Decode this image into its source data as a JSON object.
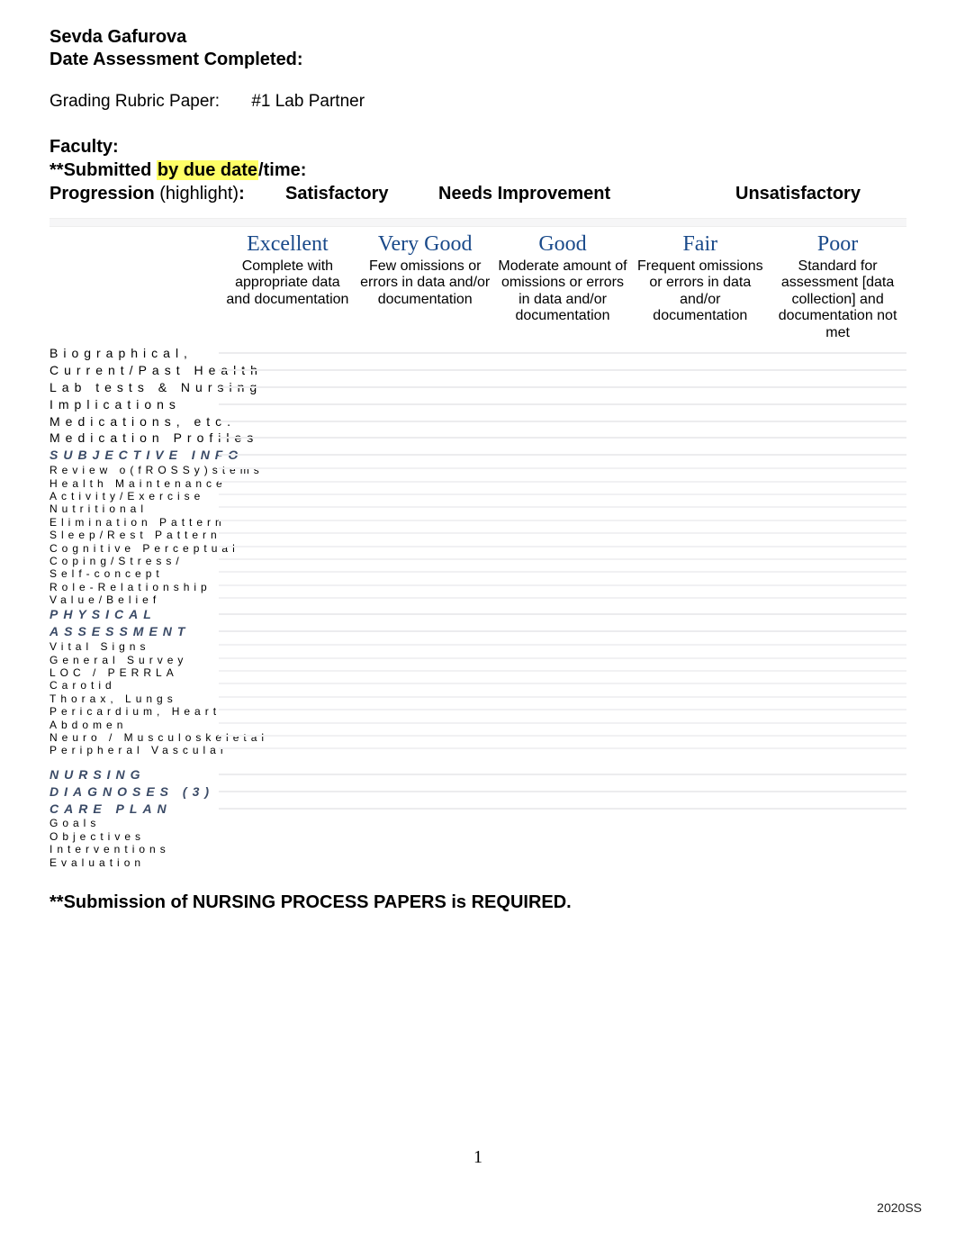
{
  "header": {
    "name": "Sevda Gafurova",
    "date_label": "Date Assessment Completed:"
  },
  "grading_line": {
    "label": "Grading Rubric Paper:",
    "value": "#1 Lab Partner"
  },
  "faculty_block": {
    "faculty_label": "Faculty:",
    "submitted_pre": "**Submitted ",
    "submitted_hl": "by due date",
    "submitted_post": "/time:",
    "progression_label_pre": "Progression ",
    "progression_label_paren": "(highlight)",
    "progression_label_post": ":",
    "satisfactory": "Satisfactory",
    "needs_improvement": "Needs Improvement",
    "unsatisfactory": "Unsatisfactory"
  },
  "grade_cols": [
    {
      "title": "Excellent",
      "desc": "Complete with appropriate data and documentation"
    },
    {
      "title": "Very Good",
      "desc": "Few omissions or errors in data and/or documentation"
    },
    {
      "title": "Good",
      "desc": "Moderate amount of omissions or errors in data and/or documentation"
    },
    {
      "title": "Fair",
      "desc": "Frequent omissions or errors in data and/or documentation"
    },
    {
      "title": "Poor",
      "desc": "Standard for assessment [data collection] and documentation not met"
    }
  ],
  "rows_top": [
    "Biographical,",
    "Current/Past Health",
    "Lab tests & Nursing",
    "Implications",
    "Medications, etc.",
    "Medication Profiles"
  ],
  "sections": {
    "subjective": {
      "head": "SUBJECTIVE INFO",
      "items": [
        "Review o(fROSSy)stems",
        "Health Maintenance",
        "Activity/Exercise",
        "Nutritional",
        "Elimination Pattern",
        "Sleep/Rest Pattern",
        "Cognitive Perceptual",
        "Coping/Stress/",
        "Self-concept",
        "Role-Relationship",
        "Value/Belief"
      ]
    },
    "physical": {
      "head1": "PHYSICAL",
      "head2": "ASSESSMENT",
      "items": [
        "Vital Signs",
        "General Survey",
        "LOC / PERRLA",
        "Carotid",
        "Thorax, Lungs",
        "Pericardium, Heart",
        "Abdomen",
        "Neuro / Musculoskeletal",
        "Peripheral Vascular"
      ]
    },
    "nursing": {
      "head1": "NURSING",
      "head2": "DIAGNOSES (3)",
      "head3": "CARE PLAN",
      "items": [
        "Goals",
        "Objectives",
        "Interventions",
        "Evaluation"
      ]
    }
  },
  "footer": {
    "note": "**Submission of NURSING PROCESS PAPERS is REQUIRED.",
    "page_num": "1",
    "stamp": "2020SS"
  }
}
